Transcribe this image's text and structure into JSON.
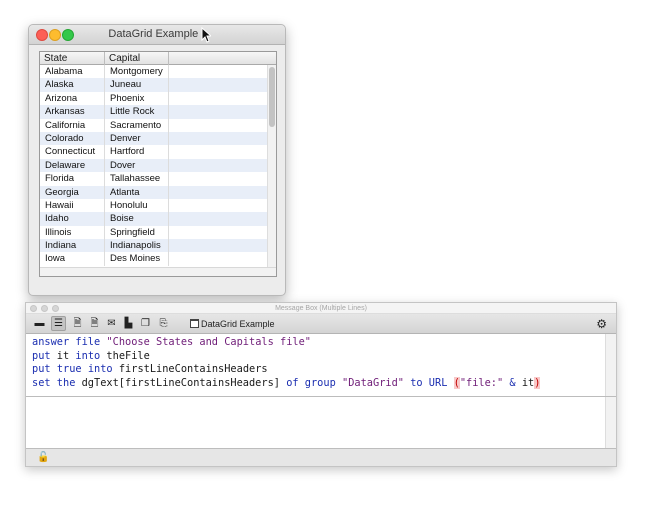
{
  "datagrid_window": {
    "title": "DataGrid Example *",
    "columns": [
      "State",
      "Capital"
    ],
    "rows": [
      {
        "state": "Alabama",
        "capital": "Montgomery"
      },
      {
        "state": "Alaska",
        "capital": "Juneau"
      },
      {
        "state": "Arizona",
        "capital": "Phoenix"
      },
      {
        "state": "Arkansas",
        "capital": "Little Rock"
      },
      {
        "state": "California",
        "capital": "Sacramento"
      },
      {
        "state": "Colorado",
        "capital": "Denver"
      },
      {
        "state": "Connecticut",
        "capital": "Hartford"
      },
      {
        "state": "Delaware",
        "capital": "Dover"
      },
      {
        "state": "Florida",
        "capital": "Tallahassee"
      },
      {
        "state": "Georgia",
        "capital": "Atlanta"
      },
      {
        "state": "Hawaii",
        "capital": "Honolulu"
      },
      {
        "state": "Idaho",
        "capital": "Boise"
      },
      {
        "state": "Illinois",
        "capital": "Springfield"
      },
      {
        "state": "Indiana",
        "capital": "Indianapolis"
      },
      {
        "state": "Iowa",
        "capital": "Des Moines"
      }
    ]
  },
  "message_box": {
    "title": "Message Box (Multiple Lines)",
    "target_stack": "DataGrid Example",
    "code_lines": [
      [
        {
          "t": "answer",
          "c": "kw"
        },
        {
          "t": " "
        },
        {
          "t": "file",
          "c": "kw"
        },
        {
          "t": " "
        },
        {
          "t": "\"Choose States and Capitals file\"",
          "c": "str"
        }
      ],
      [
        {
          "t": "put",
          "c": "kw"
        },
        {
          "t": " it "
        },
        {
          "t": "into",
          "c": "kw"
        },
        {
          "t": " theFile"
        }
      ],
      [
        {
          "t": "put",
          "c": "kw"
        },
        {
          "t": " "
        },
        {
          "t": "true",
          "c": "kw"
        },
        {
          "t": " "
        },
        {
          "t": "into",
          "c": "kw"
        },
        {
          "t": " firstLineContainsHeaders"
        }
      ],
      [
        {
          "t": "set the",
          "c": "kw"
        },
        {
          "t": " dgText[firstLineContainsHeaders] "
        },
        {
          "t": "of group",
          "c": "kw"
        },
        {
          "t": " "
        },
        {
          "t": "\"DataGrid\"",
          "c": "str"
        },
        {
          "t": " "
        },
        {
          "t": "to URL",
          "c": "kw"
        },
        {
          "t": " "
        },
        {
          "t": "(",
          "c": "err"
        },
        {
          "t": "\"file:\"",
          "c": "str"
        },
        {
          "t": " "
        },
        {
          "t": "&",
          "c": "kw"
        },
        {
          "t": " it"
        },
        {
          "t": ")",
          "c": "err"
        }
      ]
    ]
  },
  "colors": {
    "keyword": "#1b2eb0",
    "string": "#6f1d78",
    "error_highlight": "#f8c9c9",
    "row_alternate": "#e8eef8"
  }
}
